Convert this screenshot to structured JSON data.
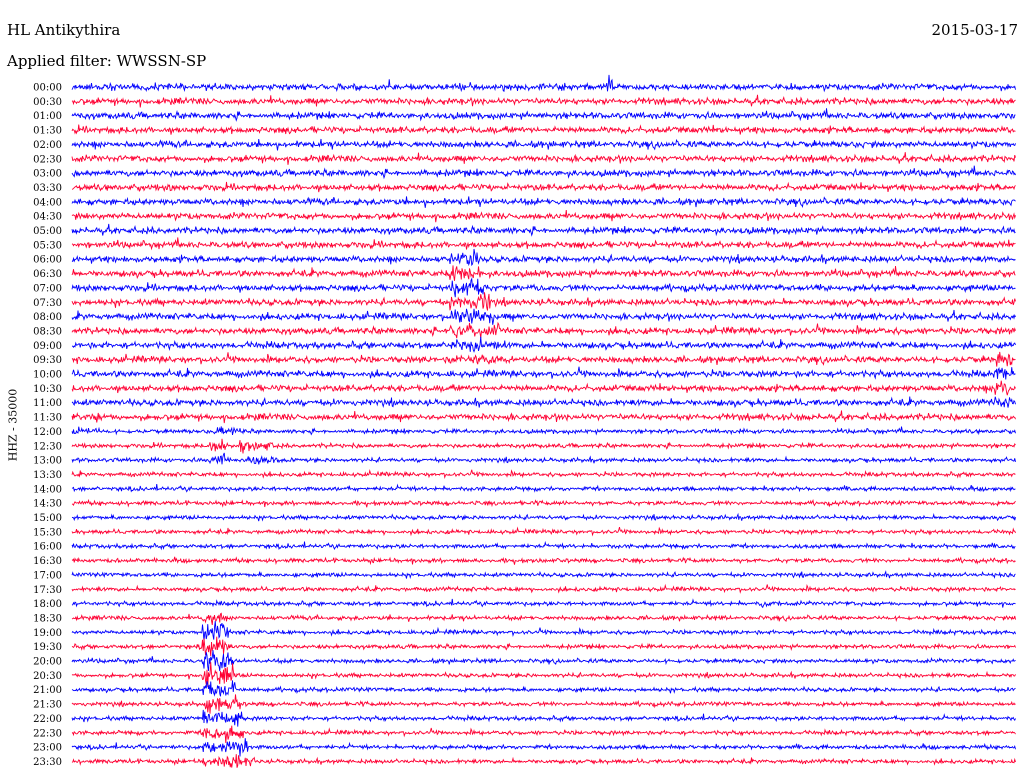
{
  "header": {
    "station": "HL Antikythira",
    "date": "2015-03-17",
    "filter": "Applied filter: WWSSN-SP"
  },
  "chart_data": {
    "type": "line",
    "title": "HL Antikythira",
    "ylabel": "HHZ - 35000",
    "row_labels": [
      "00:00",
      "00:30",
      "01:00",
      "01:30",
      "02:00",
      "02:30",
      "03:00",
      "03:30",
      "04:00",
      "04:30",
      "05:00",
      "05:30",
      "06:00",
      "06:30",
      "07:00",
      "07:30",
      "08:00",
      "08:30",
      "09:00",
      "09:30",
      "10:00",
      "10:30",
      "11:00",
      "11:30",
      "12:00",
      "12:30",
      "13:00",
      "13:30",
      "14:00",
      "14:30",
      "15:00",
      "15:30",
      "16:00",
      "16:30",
      "17:00",
      "17:30",
      "18:00",
      "18:30",
      "19:00",
      "19:30",
      "20:00",
      "20:30",
      "21:00",
      "21:30",
      "22:00",
      "22:30",
      "23:00",
      "23:30"
    ],
    "trace_colors": [
      "#0000ff",
      "#ff0033"
    ],
    "grid": false
  }
}
